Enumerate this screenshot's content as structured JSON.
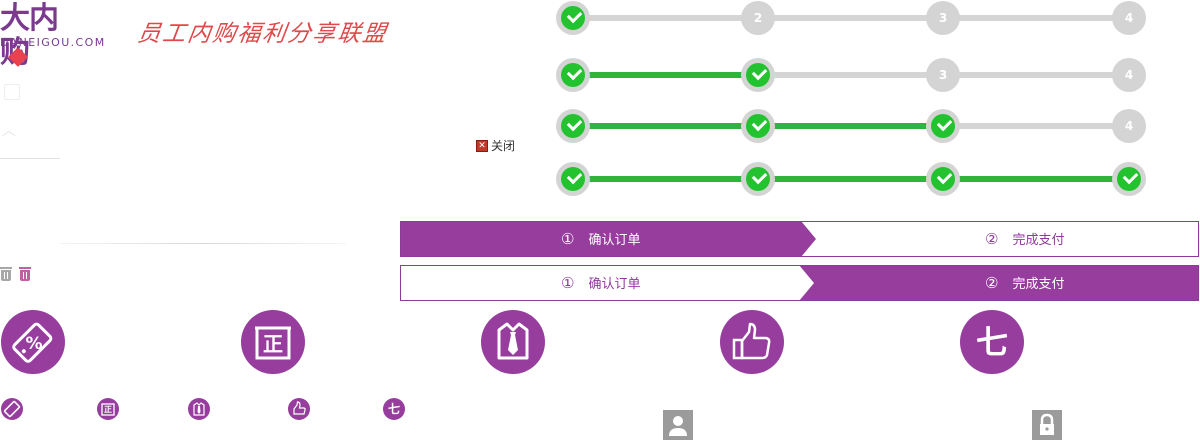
{
  "logo": {
    "name_cn": "大内购",
    "name_en": "DANEIGOU.COM",
    "slogan": "员工内购福利分享联盟"
  },
  "close_label": "关闭",
  "close_icon": "close-x-icon",
  "progress_rows": [
    {
      "steps": [
        "",
        "2",
        "3",
        "4"
      ],
      "completed": 1
    },
    {
      "steps": [
        "",
        "",
        "3",
        "4"
      ],
      "completed": 2
    },
    {
      "steps": [
        "",
        "",
        "",
        "4"
      ],
      "completed": 3
    },
    {
      "steps": [
        "",
        "",
        "",
        ""
      ],
      "completed": 4
    }
  ],
  "order_steps": {
    "step1_num": "①",
    "step1_label": "确认订单",
    "step2_num": "②",
    "step2_label": "完成支付"
  },
  "order_bars": [
    {
      "active_step": 1
    },
    {
      "active_step": 2
    }
  ],
  "feature_icons": [
    {
      "icon": "discount-tag-icon"
    },
    {
      "icon": "genuine-icon",
      "glyph": "正"
    },
    {
      "icon": "shirt-tie-icon"
    },
    {
      "icon": "thumbs-up-icon"
    },
    {
      "icon": "seven-days-icon",
      "glyph": "七"
    }
  ],
  "colors": {
    "brand_purple": "#963d9e",
    "step_done": "#22c32f",
    "step_pending": "#d4d4d4",
    "slogan_red": "#e0484b"
  }
}
